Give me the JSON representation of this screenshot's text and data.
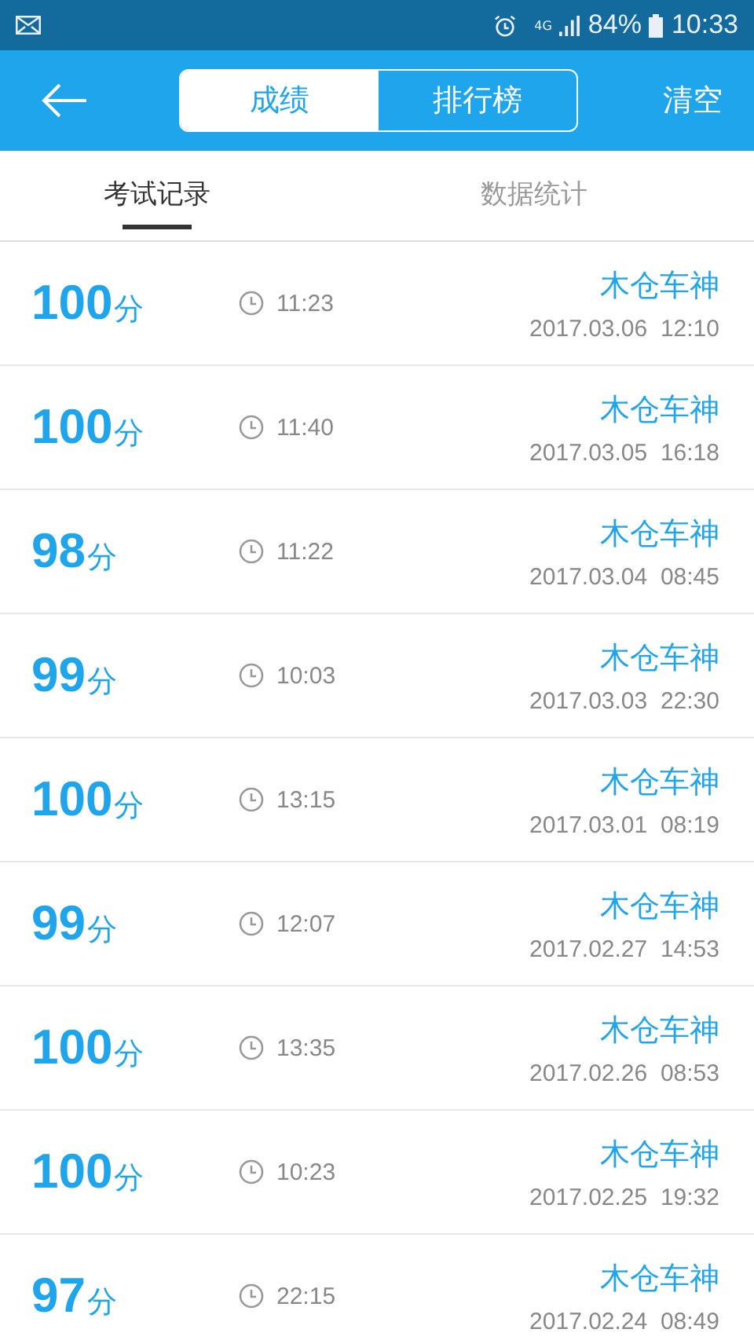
{
  "status_bar": {
    "network": "4G",
    "battery": "84%",
    "time": "10:33"
  },
  "header": {
    "segments": [
      {
        "label": "成绩",
        "selected": true
      },
      {
        "label": "排行榜",
        "selected": false
      }
    ],
    "action": "清空"
  },
  "tabs": [
    {
      "label": "考试记录",
      "selected": true
    },
    {
      "label": "数据统计",
      "selected": false
    }
  ],
  "records": [
    {
      "score": "100",
      "unit": "分",
      "duration": "11:23",
      "name": "木仓车神",
      "date": "2017.03.06  12:10"
    },
    {
      "score": "100",
      "unit": "分",
      "duration": "11:40",
      "name": "木仓车神",
      "date": "2017.03.05  16:18"
    },
    {
      "score": "98",
      "unit": "分",
      "duration": "11:22",
      "name": "木仓车神",
      "date": "2017.03.04  08:45"
    },
    {
      "score": "99",
      "unit": "分",
      "duration": "10:03",
      "name": "木仓车神",
      "date": "2017.03.03  22:30"
    },
    {
      "score": "100",
      "unit": "分",
      "duration": "13:15",
      "name": "木仓车神",
      "date": "2017.03.01  08:19"
    },
    {
      "score": "99",
      "unit": "分",
      "duration": "12:07",
      "name": "木仓车神",
      "date": "2017.02.27  14:53"
    },
    {
      "score": "100",
      "unit": "分",
      "duration": "13:35",
      "name": "木仓车神",
      "date": "2017.02.26  08:53"
    },
    {
      "score": "100",
      "unit": "分",
      "duration": "10:23",
      "name": "木仓车神",
      "date": "2017.02.25  19:32"
    },
    {
      "score": "97",
      "unit": "分",
      "duration": "22:15",
      "name": "木仓车神",
      "date": "2017.02.24  08:49"
    }
  ]
}
